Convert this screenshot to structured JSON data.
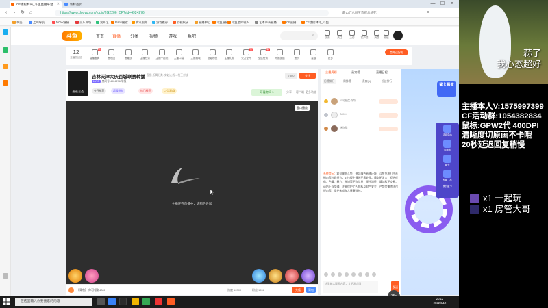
{
  "browser": {
    "tabs": [
      {
        "label": "CF建控林哥_斗鱼直播平台",
        "active": true
      },
      {
        "label": "新标签页",
        "active": false
      }
    ],
    "url": "https://www.douyu.com/topic/2G2206_CF?rid=4924276",
    "address_extra": "最山灯八翻五造成总统死",
    "bookmarks": [
      "书签",
      "上网导航",
      "NOW直播",
      "京东商城",
      "爱奇艺",
      "Rank搜索",
      "腾讯视频",
      "游戏推荐",
      "云视娱乐",
      "直播中心",
      "斗鱼直播",
      "斗鱼星际输入",
      "艺术手表直播",
      "CF直播",
      "CF建控林哥_斗鱼"
    ],
    "window_controls": [
      "—",
      "☐",
      "✕"
    ]
  },
  "site": {
    "logo": "斗鱼",
    "nav": [
      {
        "label": "首页",
        "active": false
      },
      {
        "label": "直播",
        "active": true
      },
      {
        "label": "分类",
        "active": false
      },
      {
        "label": "视频",
        "active": false
      },
      {
        "label": "游戏",
        "active": false
      },
      {
        "label": "鱼吧",
        "active": false
      }
    ],
    "header_icons": [
      "历史",
      "关注",
      "上传",
      "客户端",
      "消息",
      "充值"
    ]
  },
  "toolbar": {
    "level": "12",
    "level_label": "主播粉丝团",
    "tools": [
      {
        "label": "直播宝典",
        "badge": "新"
      },
      {
        "label": "鱼乐团",
        "badge": ""
      },
      {
        "label": "鱼塘战",
        "badge": ""
      },
      {
        "label": "主播任务",
        "badge": ""
      },
      {
        "label": "主播一起玩",
        "badge": ""
      },
      {
        "label": "主播口袋",
        "badge": ""
      },
      {
        "label": "主播商城",
        "badge": ""
      },
      {
        "label": "超级粉丝",
        "badge": ""
      },
      {
        "label": "主播礼物",
        "badge": ""
      },
      {
        "label": "火力全开",
        "badge": "热"
      },
      {
        "label": "全民任务",
        "badge": "新"
      },
      {
        "label": "开播提醒",
        "badge": ""
      },
      {
        "label": "鱼乐",
        "badge": ""
      },
      {
        "label": "星级",
        "badge": ""
      },
      {
        "label": "更多",
        "badge": ""
      }
    ],
    "first_recharge": "首充送好礼"
  },
  "room": {
    "title": "吉林天津大庆百城联赛转播",
    "category": "直播  所属分类: 穿越火线 > 枪王对战",
    "meta_tag": "LV13",
    "meta_text": "房间号 4924276  举报",
    "pills": [
      "今日推荐",
      "超级粉丝",
      "热门标签",
      "CF活动群"
    ],
    "follow": "关注",
    "report": "7800",
    "watch": "可看房间 1",
    "right_links": [
      "分享",
      "客户端",
      "更多功能"
    ],
    "avatar_text": "绝地 | 公会"
  },
  "video": {
    "toggle": "窗口播放",
    "status": "主播正在直播中，请稍后尝试"
  },
  "player_bar": {
    "text": "【背包】 你可领取4000",
    "viewers": "热度 12000",
    "fans": "粉丝 1208",
    "recharge": "充值",
    "bag": "背包"
  },
  "chat": {
    "tabs": [
      {
        "label": "主播周榜",
        "active": true
      },
      {
        "label": "贵宾榜",
        "active": false
      },
      {
        "label": "直播日程",
        "active": false
      }
    ],
    "subtabs": [
      {
        "label": "日榜排行",
        "active": true
      },
      {
        "label": "周排榜",
        "active": false
      },
      {
        "label": "贵宾(1)",
        "active": false
      },
      {
        "label": "粉丝排行",
        "active": false
      }
    ],
    "ranks": [
      "11号抽奖哥哥",
      "Tuffet",
      "迷你猫"
    ],
    "notice_label": "系统提示：",
    "notice": "欢迎来到斗鱼！倡导绿色直播环境，斗鱼坚决打击直播内容违规行为，对违规主播将严肃处理。请文明发言，拒绝低俗、色情、暴力、赌博等不良信息，理性消费，请勿私下交易，谨防上当受骗，注意保护个人隐私及财产安全，严禁传播违法违规内容，保护未成年人健康成长。",
    "input_placeholder": "这里输入聊天内容，文明发言哦",
    "send": "发送",
    "timer": "35s"
  },
  "promo": {
    "badge": "鲨卡 殿堂",
    "menu": [
      "活动中心",
      "沙滩卡",
      "鲨卡",
      "大鲨飞车",
      "我的鲨卡"
    ]
  },
  "taskbar": {
    "search": "在这里输入你要搜索的内容",
    "time": "20:12",
    "date": "2022/6/12"
  },
  "overlay": {
    "mascot_text": [
      "蒜了",
      "我心态超好"
    ],
    "lines": [
      "主播本人V:1575997399",
      "CF活动群:1054382834",
      "鼠标:GPW2代 400DPI",
      "清晰度切原画不卡哦",
      "20秒延迟回复稍慢"
    ],
    "gifts": [
      {
        "text": "x1 一起玩"
      },
      {
        "text": "x1 房管大哥"
      }
    ]
  },
  "colors": {
    "accent": "#ff5d23",
    "brand": "#ff7a00",
    "video_bg": "#2e2e2e",
    "overlay_bg": "#000000"
  }
}
